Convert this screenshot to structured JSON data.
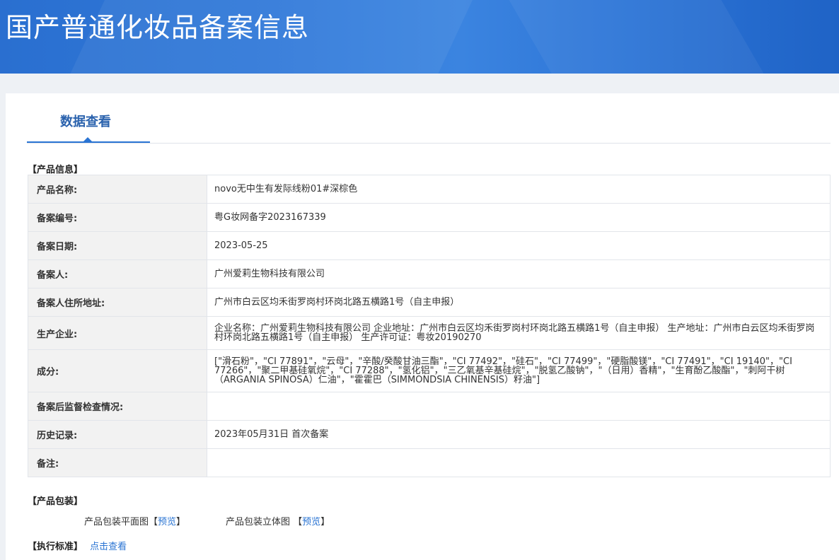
{
  "header": {
    "title": "国产普通化妆品备案信息"
  },
  "tabs": [
    {
      "label": "数据查看"
    }
  ],
  "product_section": {
    "title": "【产品信息】",
    "rows": [
      {
        "label": "产品名称:",
        "value": "novo无中生有发际线粉01#深棕色"
      },
      {
        "label": "备案编号:",
        "value": "粤G妆网备字2023167339"
      },
      {
        "label": "备案日期:",
        "value": "2023-05-25"
      },
      {
        "label": "备案人:",
        "value": "广州爱莉生物科技有限公司"
      },
      {
        "label": "备案人住所地址:",
        "value": "广州市白云区均禾街罗岗村环岗北路五横路1号（自主申报）"
      },
      {
        "label": "生产企业:",
        "value": "企业名称：广州爱莉生物科技有限公司 企业地址：广州市白云区均禾街罗岗村环岗北路五横路1号（自主申报） 生产地址：广州市白云区均禾街罗岗村环岗北路五横路1号（自主申报） 生产许可证：粤妆20190270"
      },
      {
        "label": "成分:",
        "value": "[\"滑石粉\"，\"CI 77891\"，\"云母\"，\"辛酸/癸酸甘油三酯\"，\"CI 77492\"，\"硅石\"，\"CI 77499\"，\"硬脂酸镁\"，\"CI 77491\"，\"CI 19140\"，\"CI 77266\"，\"聚二甲基硅氧烷\"，\"CI 77288\"，\"氢化铝\"，\"三乙氧基辛基硅烷\"，\"脱氢乙酸钠\"，\"（日用）香精\"，\"生育酚乙酸酯\"，\"刺阿干树（ARGANIA SPINOSA）仁油\"，\"霍霍巴（SIMMONDSIA CHINENSIS）籽油\"]"
      },
      {
        "label": "备案后监督检查情况:",
        "value": ""
      },
      {
        "label": "历史记录:",
        "value": "2023年05月31日 首次备案"
      },
      {
        "label": "备注:",
        "value": ""
      }
    ]
  },
  "package_section": {
    "title": "【产品包装】",
    "flat_label": "产品包装平面图",
    "flat_link": "预览",
    "solid_label": "产品包装立体图",
    "solid_link": "预览"
  },
  "standard_section": {
    "title": "【执行标准】",
    "link": "点击查看"
  }
}
